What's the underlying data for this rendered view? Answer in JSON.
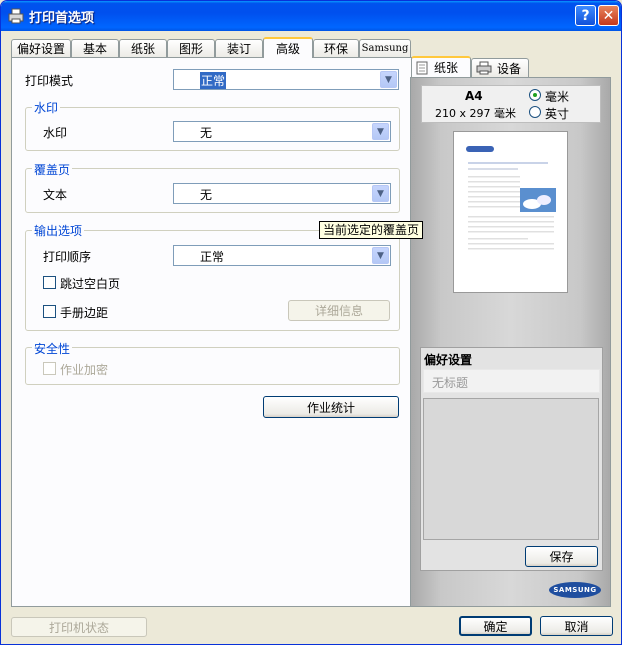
{
  "window": {
    "title": "打印首选项"
  },
  "tabs": [
    {
      "label": "偏好设置"
    },
    {
      "label": "基本"
    },
    {
      "label": "纸张"
    },
    {
      "label": "图形"
    },
    {
      "label": "装订"
    },
    {
      "label": "高级"
    },
    {
      "label": "环保"
    },
    {
      "label": "Samsung"
    }
  ],
  "advanced": {
    "print_mode_label": "打印模式",
    "print_mode_value": "正常",
    "watermark": {
      "group_title": "水印",
      "label": "水印",
      "value": "无"
    },
    "overlay": {
      "group_title": "覆盖页",
      "label": "文本",
      "value": "无",
      "tooltip": "当前选定的覆盖页"
    },
    "output": {
      "group_title": "输出选项",
      "order_label": "打印顺序",
      "order_value": "正常",
      "skip_blank_label": "跳过空白页",
      "booklet_margin_label": "手册边距",
      "details_button": "详细信息"
    },
    "security": {
      "group_title": "安全性",
      "job_encrypt_label": "作业加密"
    },
    "job_accounting_button": "作业统计"
  },
  "preview": {
    "tabs": [
      {
        "label": "纸张"
      },
      {
        "label": "设备"
      }
    ],
    "paper_size": "A4",
    "paper_dims": "210 x 297 毫米",
    "unit_mm": "毫米",
    "unit_inch": "英寸",
    "logo_text": "SAMSUNG"
  },
  "favorites": {
    "title": "偏好设置",
    "placeholder": "无标题",
    "save_button": "保存"
  },
  "footer": {
    "printer_status_button": "打印机状态",
    "ok_button": "确定",
    "cancel_button": "取消"
  }
}
